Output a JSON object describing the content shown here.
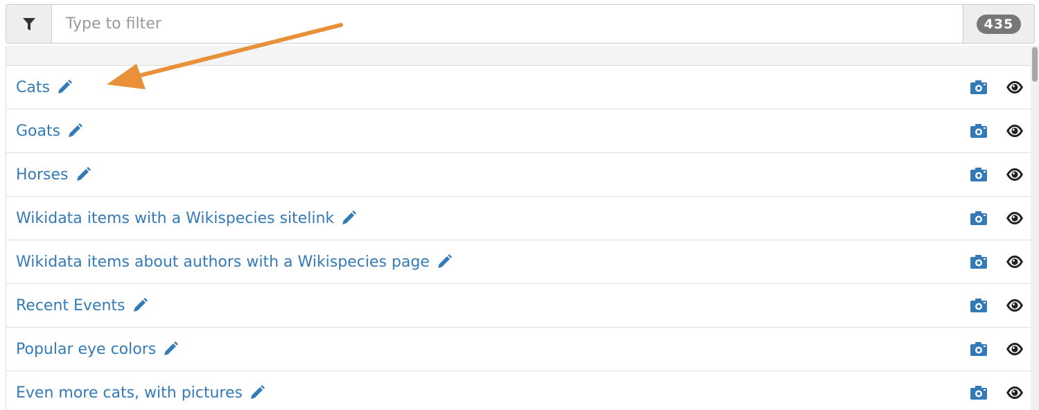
{
  "filter": {
    "placeholder": "Type to filter",
    "value": "",
    "icon": "filter-icon",
    "count": "435"
  },
  "list": {
    "items": [
      {
        "label": "Cats"
      },
      {
        "label": "Goats"
      },
      {
        "label": "Horses"
      },
      {
        "label": "Wikidata items with a Wikispecies sitelink"
      },
      {
        "label": "Wikidata items about authors with a Wikispecies page"
      },
      {
        "label": "Recent Events"
      },
      {
        "label": "Popular eye colors"
      },
      {
        "label": "Even more cats, with pictures"
      }
    ],
    "row_icons": [
      "pencil-icon",
      "camera-icon",
      "eye-icon"
    ]
  },
  "colors": {
    "link": "#337ab7",
    "badge": "#777777",
    "annotation_arrow": "#e8913a"
  }
}
